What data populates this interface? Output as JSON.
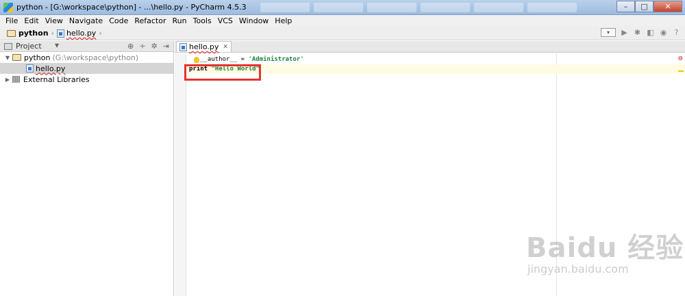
{
  "window": {
    "title": "python - [G:\\workspace\\python] - ...\\hello.py - PyCharm 4.5.3",
    "minimize": "–",
    "maximize": "□",
    "close": "✕"
  },
  "menu": [
    "File",
    "Edit",
    "View",
    "Navigate",
    "Code",
    "Refactor",
    "Run",
    "Tools",
    "VCS",
    "Window",
    "Help"
  ],
  "navbar": {
    "project": "python",
    "file": "hello.py"
  },
  "project_panel": {
    "title": "Project",
    "tree": {
      "root_name": "python",
      "root_path": "(G:\\workspace\\python)",
      "child_file": "hello.py",
      "libraries": "External Libraries"
    }
  },
  "editor": {
    "tab_label": "hello.py",
    "lines": {
      "line1_var": "__author__",
      "line1_op": " = ",
      "line1_str": "'Administrator'",
      "line2_kw": "print",
      "line2_str": " \"Hello World\""
    }
  },
  "watermark": {
    "main": "Baidu 经验",
    "sub": "jingyan.baidu.com"
  }
}
